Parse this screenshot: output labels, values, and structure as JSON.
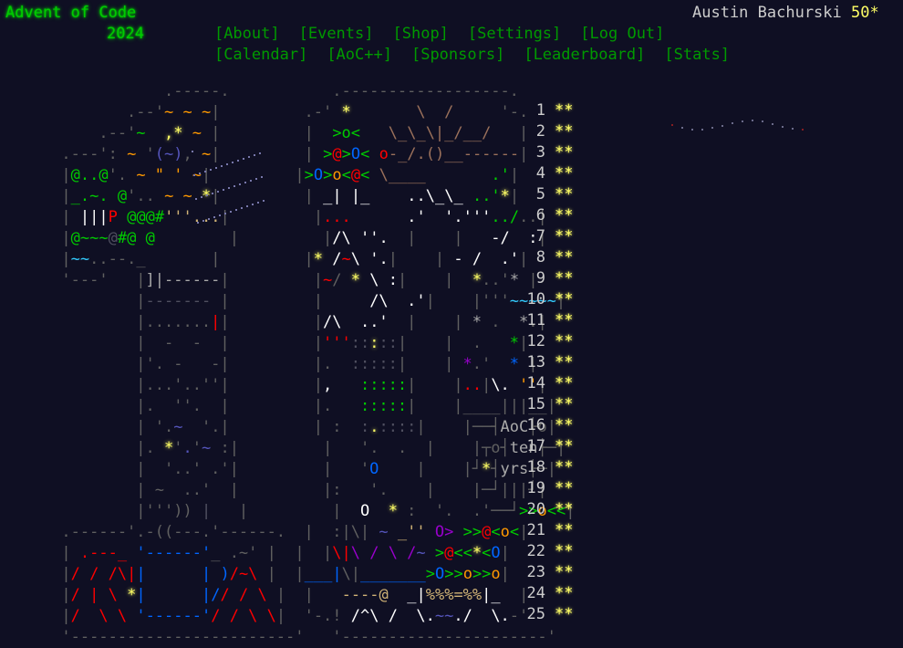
{
  "header": {
    "title": "Advent of Code",
    "year": "2024",
    "nav_row_1": [
      "[About]",
      "[Events]",
      "[Shop]",
      "[Settings]",
      "[Log Out]"
    ],
    "nav_row_2": [
      "[Calendar]",
      "[AoC++]",
      "[Sponsors]",
      "[Leaderboard]",
      "[Stats]"
    ],
    "user_name": "Austin Bachurski",
    "user_stars": "50*"
  },
  "calendar": {
    "days": [
      {
        "day": "1",
        "stars": "**"
      },
      {
        "day": "2",
        "stars": "**"
      },
      {
        "day": "3",
        "stars": "**"
      },
      {
        "day": "4",
        "stars": "**"
      },
      {
        "day": "5",
        "stars": "**"
      },
      {
        "day": "6",
        "stars": "**"
      },
      {
        "day": "7",
        "stars": "**"
      },
      {
        "day": "8",
        "stars": "**"
      },
      {
        "day": "9",
        "stars": "**"
      },
      {
        "day": "10",
        "stars": "**"
      },
      {
        "day": "11",
        "stars": "**"
      },
      {
        "day": "12",
        "stars": "**"
      },
      {
        "day": "13",
        "stars": "**"
      },
      {
        "day": "14",
        "stars": "**"
      },
      {
        "day": "15",
        "stars": "**"
      },
      {
        "day": "16",
        "stars": "**"
      },
      {
        "day": "17",
        "stars": "**"
      },
      {
        "day": "18",
        "stars": "**"
      },
      {
        "day": "19",
        "stars": "**"
      },
      {
        "day": "20",
        "stars": "**"
      },
      {
        "day": "21",
        "stars": "**"
      },
      {
        "day": "22",
        "stars": "**"
      },
      {
        "day": "23",
        "stars": "**"
      },
      {
        "day": "24",
        "stars": "**"
      },
      {
        "day": "25",
        "stars": "**"
      }
    ],
    "badge_lines": [
      "AoC",
      "ten",
      "yrs"
    ]
  },
  "colors": {
    "background": "#0f0f23",
    "title_green": "#00cc00",
    "nav_green": "#009900",
    "star_yellow": "#ffff66",
    "text": "#cccccc"
  }
}
